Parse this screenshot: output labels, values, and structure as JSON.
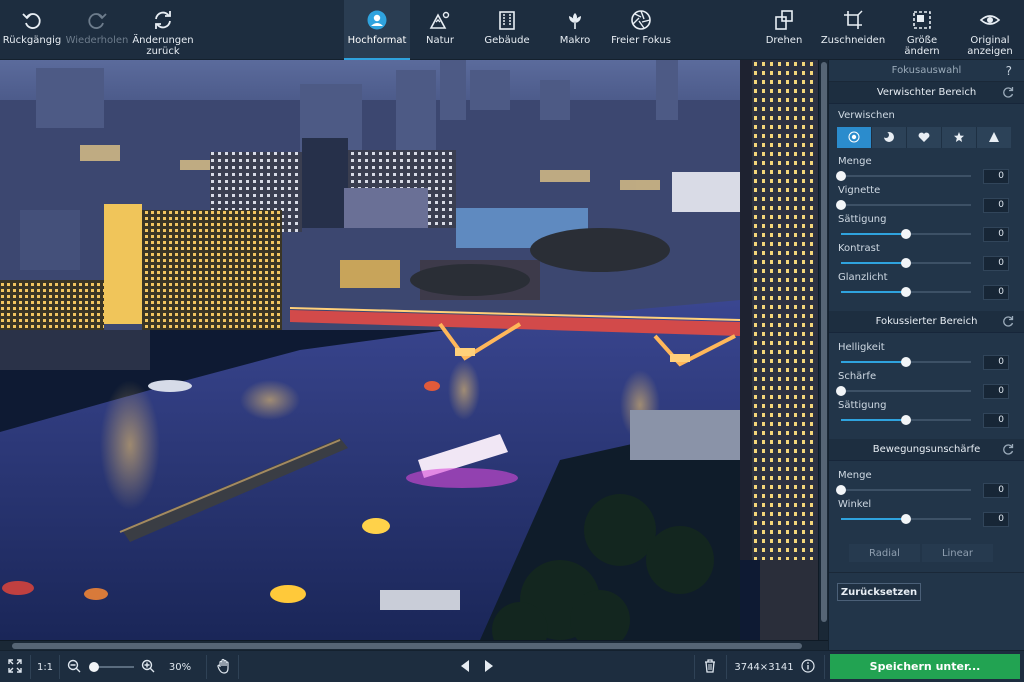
{
  "toolbar": {
    "undo": "Rückgängig",
    "redo": "Wiederholen",
    "revert": "Änderungen\nzurück",
    "presets": [
      "Hochformat",
      "Natur",
      "Gebäude",
      "Makro",
      "Freier Fokus"
    ],
    "rotate": "Drehen",
    "crop": "Zuschneiden",
    "resize": "Größe\nändern",
    "show_original": "Original\nanzeigen"
  },
  "panel": {
    "title": "Fokusauswahl",
    "help": "?",
    "blurred_section": {
      "title": "Verwischter Bereich",
      "blur_label": "Verwischen",
      "shapes": [
        "circle-shape-icon",
        "circle-half-icon",
        "heart-icon",
        "star-icon",
        "triangle-icon"
      ],
      "sliders": [
        {
          "label": "Menge",
          "value": "0",
          "level": 0
        },
        {
          "label": "Vignette",
          "value": "0",
          "level": 0
        },
        {
          "label": "Sättigung",
          "value": "0",
          "level": 0.5
        },
        {
          "label": "Kontrast",
          "value": "0",
          "level": 0.5
        },
        {
          "label": "Glanzlicht",
          "value": "0",
          "level": 0.5
        }
      ]
    },
    "focused_section": {
      "title": "Fokussierter Bereich",
      "sliders": [
        {
          "label": "Helligkeit",
          "value": "0",
          "level": 0.5
        },
        {
          "label": "Schärfe",
          "value": "0",
          "level": 0
        },
        {
          "label": "Sättigung",
          "value": "0",
          "level": 0.5
        }
      ]
    },
    "motion_section": {
      "title": "Bewegungsunschärfe",
      "sliders": [
        {
          "label": "Menge",
          "value": "0",
          "level": 0
        },
        {
          "label": "Winkel",
          "value": "0",
          "level": 0.5
        }
      ],
      "modes": [
        "Radial",
        "Linear"
      ]
    },
    "reset_button": "Zurücksetzen"
  },
  "bottom": {
    "ratio": "1:1",
    "zoom": "30%",
    "zoom_level": 0.05,
    "dimensions": "3744×3141",
    "save": "Speichern unter..."
  },
  "colors": {
    "accent": "#2fa3de",
    "save_green": "#22a352",
    "panel_bg": "#223549",
    "toolbar_bg": "#1d2d3f"
  }
}
